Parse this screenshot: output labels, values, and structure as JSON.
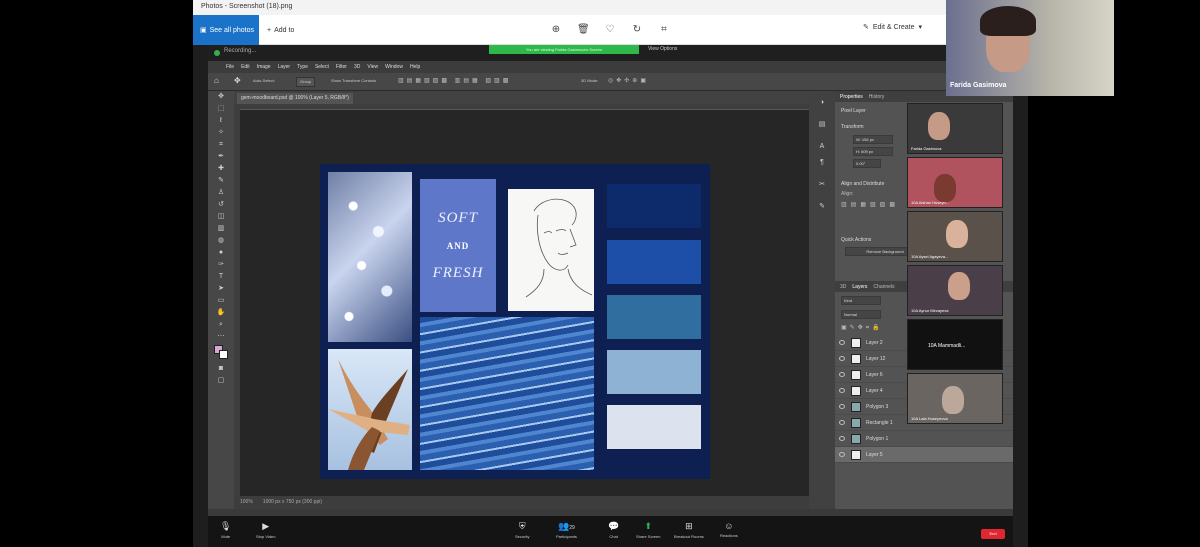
{
  "photos": {
    "window_title": "Photos - Screenshot (18).png",
    "see_all_label": "See all photos",
    "add_to_label": "Add to",
    "edit_create_label": "Edit & Create"
  },
  "share": {
    "recording_label": "Recording...",
    "banner": "You are viewing Farida Gasimova's Screen",
    "view_options": "View Options"
  },
  "photoshop": {
    "menu": [
      "File",
      "Edit",
      "Image",
      "Layer",
      "Type",
      "Select",
      "Filter",
      "3D",
      "View",
      "Window",
      "Help"
    ],
    "options": {
      "auto_select": "Auto-Select:",
      "group": "Group",
      "show_transform": "Show Transform Controls",
      "mode_3d": "3D Mode:"
    },
    "doc_tab": "gem-moodboard.psd @ 100% (Layer 5, RGB/8*)",
    "status_zoom": "100%",
    "status_size": "1000 px x 750 px (300 ppi)",
    "properties": {
      "tabs": [
        "Properties",
        "History"
      ],
      "pixel_layer": "Pixel Layer",
      "transform": "Transform",
      "w_value": "W: 156 px",
      "h_value": "H: 609 px",
      "angle_value": "0.00°",
      "align_distribute": "Align and Distribute",
      "align_label": "Align:",
      "quick_actions": "Quick Actions",
      "remove_background": "Remove Background"
    },
    "layers": {
      "tabs": [
        "3D",
        "Layers",
        "Channels"
      ],
      "kind": "Kind",
      "blend_mode": "Normal",
      "rows": [
        "Layer 2",
        "Layer 12",
        "Layer 6",
        "Layer 4",
        "Polygon 3",
        "Rectangle 1",
        "Polygon 1",
        "Layer 5"
      ]
    }
  },
  "moodboard": {
    "word_soft": "SOFT",
    "word_and": "AND",
    "word_fresh": "FRESH",
    "swatches": [
      "#0d2a6b",
      "#1d4ea8",
      "#2f6e9e",
      "#8db2d3",
      "#dde3ee"
    ]
  },
  "zoom": {
    "speaker_name": "Farida Gasimova",
    "participants": [
      {
        "label": "Farida Gasimova"
      },
      {
        "label": "10A Aishan Huseyn..."
      },
      {
        "label": "10A Aysel Agayeva..."
      },
      {
        "label": "10A Aynur Mirzayeva"
      },
      {
        "label": "10A Mammadli..."
      },
      {
        "label": "10A Lala Huseynova"
      }
    ],
    "bar": {
      "mute": "Mute",
      "stop_video": "Stop Video",
      "security": "Security",
      "participants": "Participants",
      "participants_count": "29",
      "chat": "Chat",
      "share_screen": "Share Screen",
      "breakout": "Breakout Rooms",
      "reactions": "Reactions",
      "end": "End"
    }
  }
}
